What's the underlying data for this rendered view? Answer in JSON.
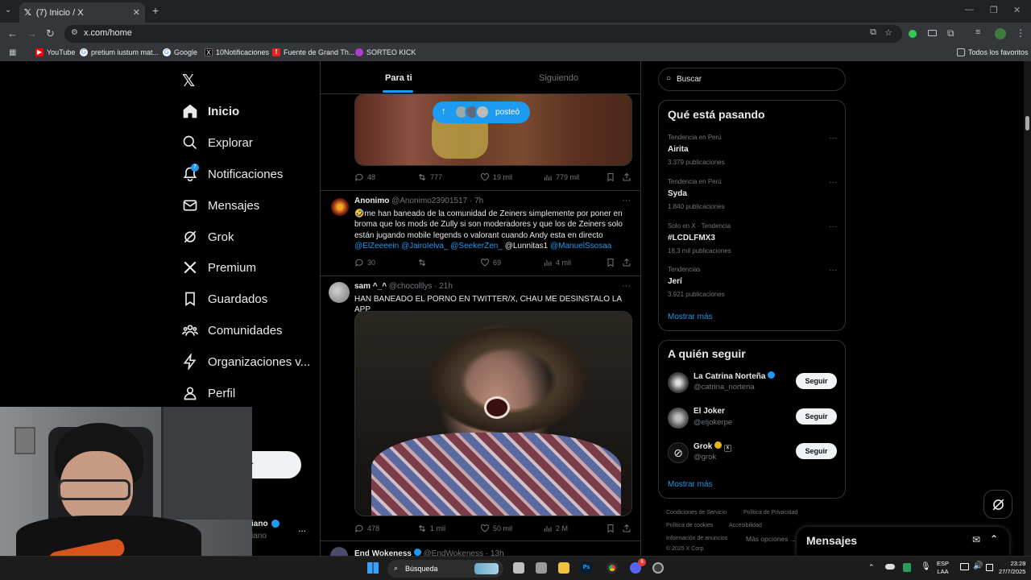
{
  "browser": {
    "tab_title": "(7) Inicio / X",
    "url": "x.com/home",
    "bookmarks": [
      "YouTube",
      "pretium iustum mat...",
      "Google",
      "10Notificaciones",
      "Fuente de Grand Th...",
      "SORTEO KICK"
    ],
    "all_bookmarks": "Todos los favoritos"
  },
  "nav": {
    "items": [
      {
        "label": "Inicio",
        "icon": "home-icon"
      },
      {
        "label": "Explorar",
        "icon": "search-icon"
      },
      {
        "label": "Notificaciones",
        "icon": "bell-icon",
        "badge": "7"
      },
      {
        "label": "Mensajes",
        "icon": "mail-icon"
      },
      {
        "label": "Grok",
        "icon": "grok-icon"
      },
      {
        "label": "Premium",
        "icon": "x-icon"
      },
      {
        "label": "Guardados",
        "icon": "bookmark-icon"
      },
      {
        "label": "Comunidades",
        "icon": "people-icon"
      },
      {
        "label": "Organizaciones v...",
        "icon": "bolt-icon"
      },
      {
        "label": "Perfil",
        "icon": "person-icon"
      },
      {
        "label": "ciones",
        "icon": "more-icon"
      }
    ],
    "post_button_partial": "r",
    "account_name_partial": "iano",
    "account_handle_partial": "iano",
    "account_more": "..."
  },
  "feed": {
    "tabs": [
      "Para ti",
      "Siguiendo"
    ],
    "new_posts_pill": "posteó",
    "post0": {
      "replies": "48",
      "reposts": "777",
      "likes": "19 mil",
      "views": "779 mil"
    },
    "post1": {
      "name": "Anonimo",
      "handle": "@Anonimo23901517",
      "time": "· 7h",
      "text": "🤣me han baneado de la comunidad de Zeiners simplemente por poner en broma que los mods de Zully si son moderadores y que los de Zeiners solo están jugando mobile legends o valorant cuando Andy esta en directo",
      "mentions": [
        "@ElZeeeein",
        "@JairoIelva_",
        "@SeekerZen_"
      ],
      "plain_mention": "@Lunnitas1",
      "last_mention": "@ManuelSsosaa",
      "replies": "30",
      "reposts": "",
      "likes": "69",
      "views": "4 mil"
    },
    "post2": {
      "name": "sam ^_^",
      "handle": "@chocolllys",
      "time": "· 21h",
      "text": "HAN BANEADO EL PORNO EN TWITTER/X, CHAU ME DESINSTALO LA APP",
      "replies": "478",
      "reposts": "1 mil",
      "likes": "50 mil",
      "views": "2 M"
    },
    "post3": {
      "name": "End Wokeness",
      "handle": "@EndWokeness",
      "time": "· 13h"
    }
  },
  "sidebar": {
    "search_placeholder": "Buscar",
    "trends_title": "Qué está pasando",
    "trends": [
      {
        "context": "Tendencia en Perú",
        "name": "Airita",
        "count": "3.379 publicaciones"
      },
      {
        "context": "Tendencia en Perú",
        "name": "Syda",
        "count": "1.840 publicaciones"
      },
      {
        "context": "Solo en X · Tendencia",
        "name": "#LCDLFMX3",
        "count": "18,3 mil publicaciones"
      },
      {
        "context": "Tendencias",
        "name": "Jerí",
        "count": "3.921 publicaciones"
      }
    ],
    "show_more": "Mostrar más",
    "follow_title": "A quién seguir",
    "follow": [
      {
        "name": "La Catrina Norteña",
        "handle": "@catrina_nortena",
        "button": "Seguir"
      },
      {
        "name": "El Joker",
        "handle": "@eljokerpe",
        "button": "Seguir"
      },
      {
        "name": "Grok",
        "handle": "@grok",
        "button": "Seguir"
      }
    ],
    "footer": [
      "Condiciones de Servicio",
      "Política de Privacidad",
      "Política de cookies",
      "Accesibilidad",
      "Información de anuncios",
      "Más opciones ...",
      "© 2025 X Corp."
    ]
  },
  "messages_drawer": "Mensajes",
  "taskbar": {
    "search": "Búsqueda",
    "lang1": "ESP",
    "lang2": "LAA",
    "time": "23:28",
    "date": "27/7/2025",
    "discord_badge": "9"
  },
  "colors": {
    "accent": "#1d9bf0",
    "background": "#000000",
    "border": "#2f3336",
    "muted": "#71767b"
  }
}
